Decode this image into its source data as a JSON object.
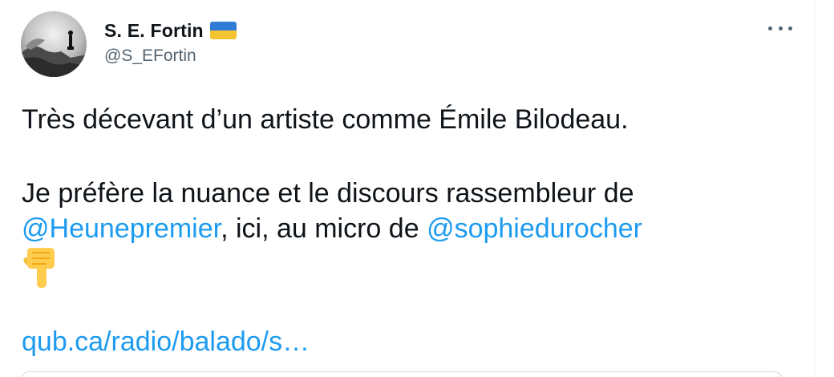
{
  "author": {
    "display_name": "S. E. Fortin",
    "handle": "@S_EFortin",
    "flag_icon": "ukraine-flag-icon",
    "avatar_icon": "avatar-image"
  },
  "tweet": {
    "line1": "Très décevant d’un artiste comme Émile Bilodeau.",
    "line2": "Je préfère la nuance et le discours rassembleur de",
    "mention1": "@Heunepremier",
    "line3_mid": ", ici, au micro de ",
    "mention2": "@sophiedurocher",
    "emoji_icon": "backhand-index-pointing-down-icon",
    "link": "qub.ca/radio/balado/s…"
  },
  "colors": {
    "link": "#1d9bf0",
    "text": "#0f1419",
    "secondary": "#536471",
    "flag_blue": "#2f7bd6",
    "flag_yellow": "#f4c430"
  }
}
